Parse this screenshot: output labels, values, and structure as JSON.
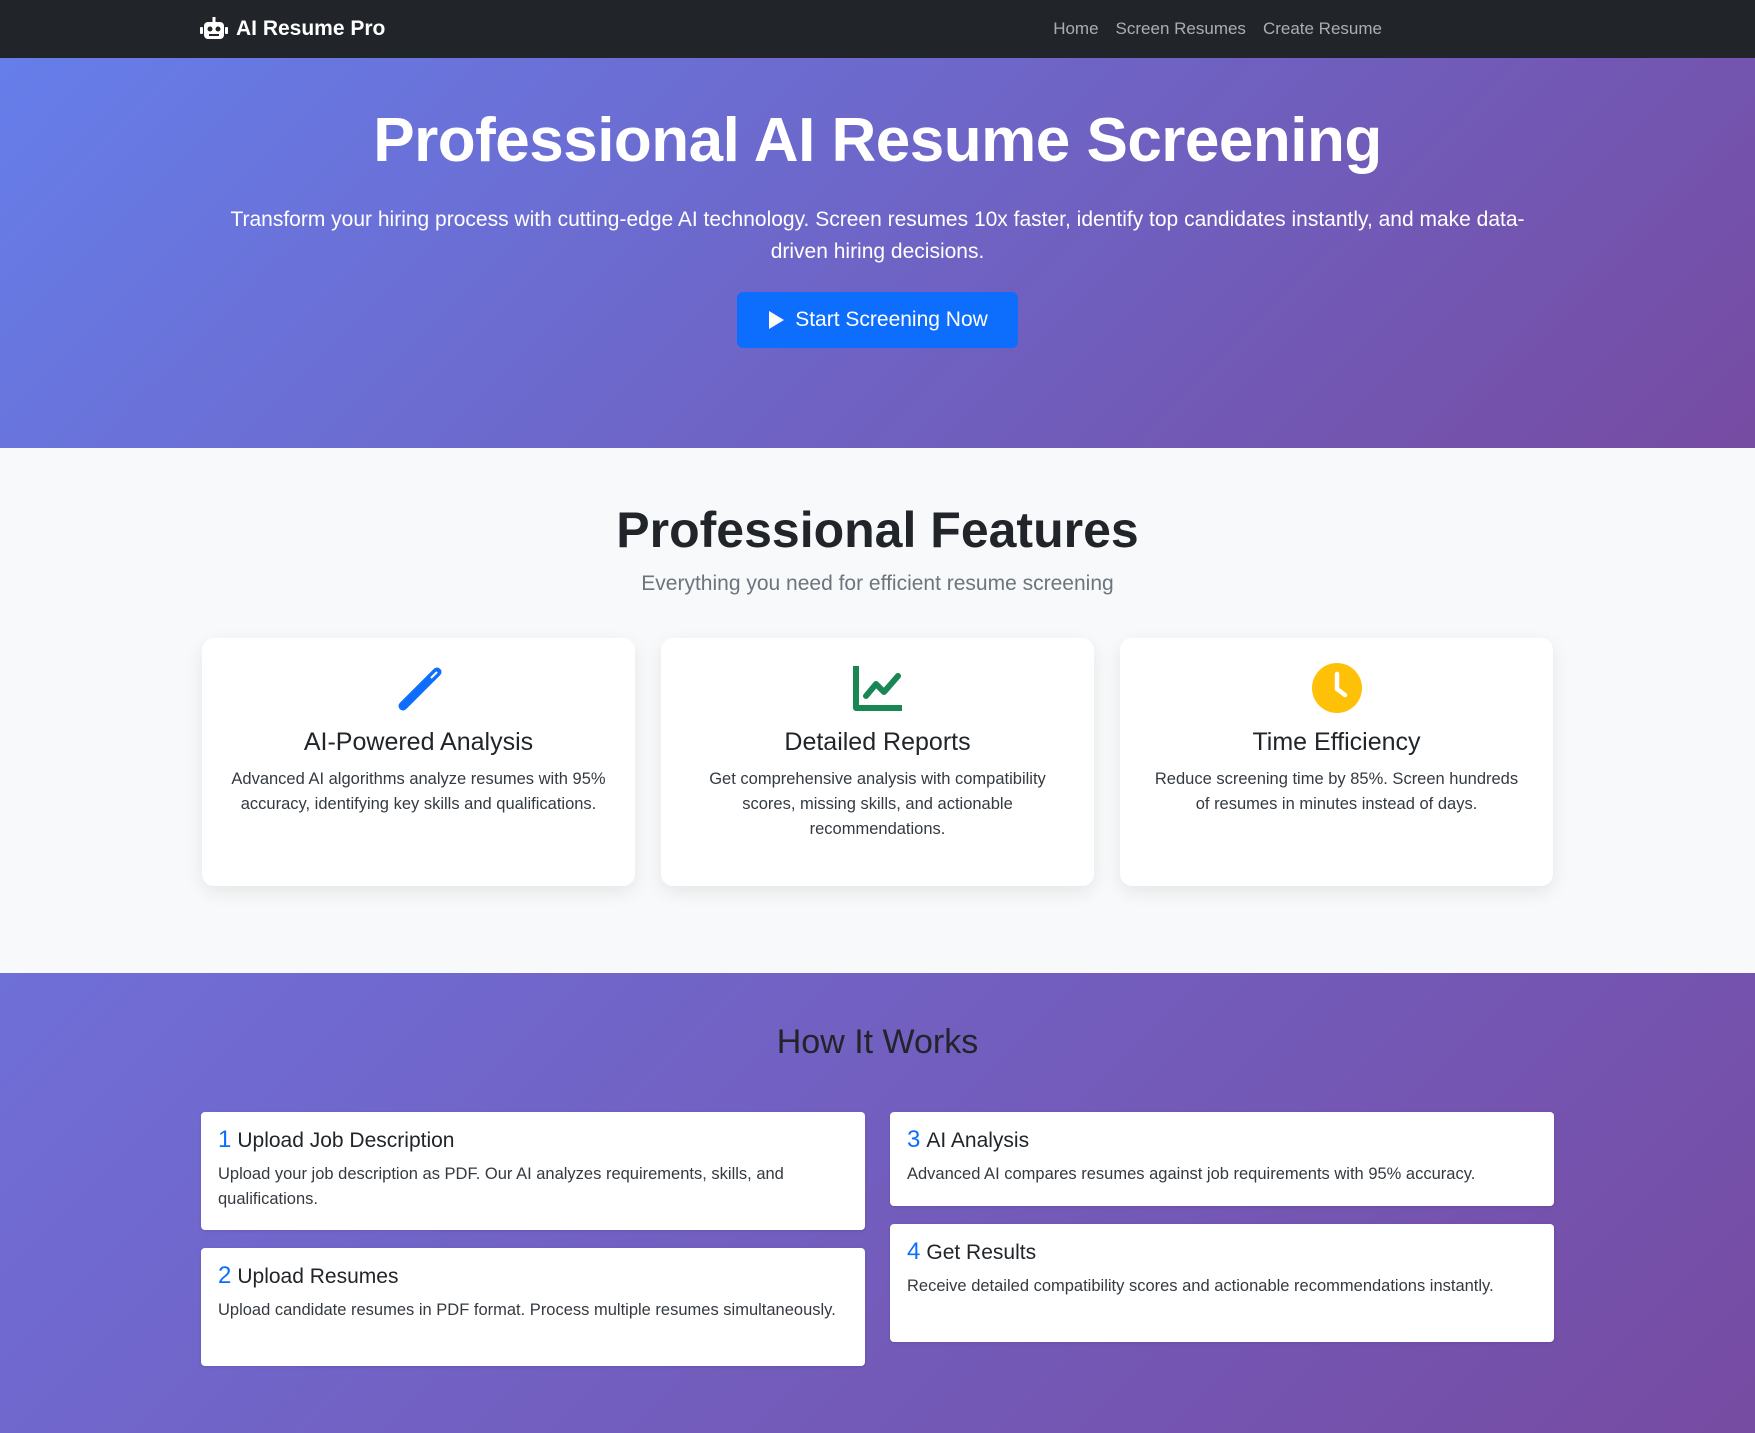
{
  "nav": {
    "brand": "AI Resume Pro",
    "links": [
      "Home",
      "Screen Resumes",
      "Create Resume"
    ]
  },
  "hero": {
    "title": "Professional AI Resume Screening",
    "subtitle": "Transform your hiring process with cutting-edge AI technology. Screen resumes 10x faster, identify top candidates instantly, and make data-driven hiring decisions.",
    "cta": "Start Screening Now"
  },
  "features": {
    "title": "Professional Features",
    "subtitle": "Everything you need for efficient resume screening",
    "cards": [
      {
        "icon": "magic-wand-icon",
        "title": "AI-Powered Analysis",
        "desc": "Advanced AI algorithms analyze resumes with 95% accuracy, identifying key skills and qualifications."
      },
      {
        "icon": "line-chart-icon",
        "title": "Detailed Reports",
        "desc": "Get comprehensive analysis with compatibility scores, missing skills, and actionable recommendations."
      },
      {
        "icon": "clock-icon",
        "title": "Time Efficiency",
        "desc": "Reduce screening time by 85%. Screen hundreds of resumes in minutes instead of days."
      }
    ]
  },
  "how": {
    "title": "How It Works",
    "steps": [
      {
        "num": "1",
        "title": "Upload Job Description",
        "desc": "Upload your job description as PDF. Our AI analyzes requirements, skills, and qualifications."
      },
      {
        "num": "2",
        "title": "Upload Resumes",
        "desc": "Upload candidate resumes in PDF format. Process multiple resumes simultaneously."
      },
      {
        "num": "3",
        "title": "AI Analysis",
        "desc": "Advanced AI compares resumes against job requirements with 95% accuracy."
      },
      {
        "num": "4",
        "title": "Get Results",
        "desc": "Receive detailed compatibility scores and actionable recommendations instantly."
      }
    ]
  },
  "colors": {
    "navbar": "#212529",
    "primary": "#0d6efd",
    "gradient_start": "#667eea",
    "gradient_end": "#764ba2",
    "chart_icon": "#198754",
    "clock_icon": "#ffc107"
  }
}
